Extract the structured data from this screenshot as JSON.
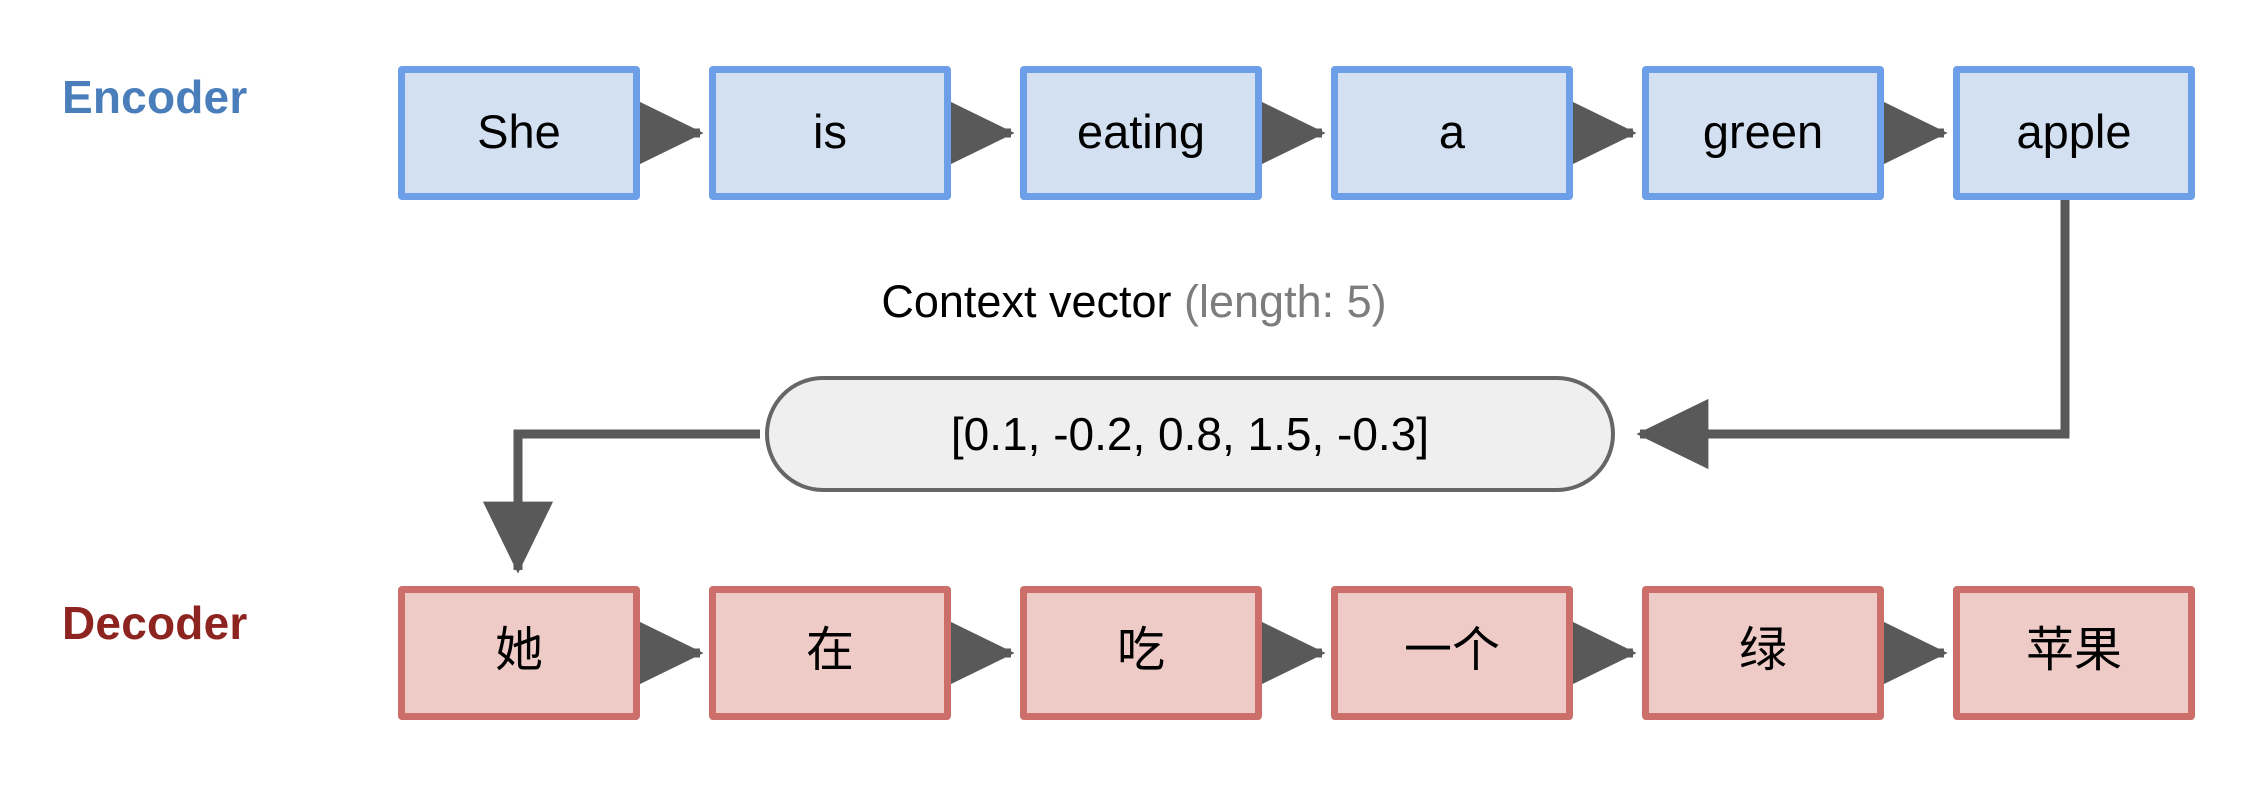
{
  "diagram": {
    "title_encoder_label": "Encoder",
    "title_decoder_label": "Decoder",
    "encoder": {
      "label": "Encoder",
      "label_color": "#4A7EBB",
      "box_fill": "#D2E0F1",
      "box_border": "#6D9EE8",
      "tokens": [
        "She",
        "is",
        "eating",
        "a",
        "green",
        "apple"
      ]
    },
    "decoder": {
      "label": "Decoder",
      "label_color": "#8E2420",
      "box_fill": "#EFCBC8",
      "box_border": "#CC6E69",
      "tokens": [
        "她",
        "在",
        "吃",
        "一个",
        "绿",
        "苹果"
      ]
    },
    "context": {
      "caption_main": "Context vector",
      "caption_suffix": "(length: 5)",
      "caption_suffix_color": "#7D7D7D",
      "values_text": "[0.1, -0.2, 0.8, 1.5, -0.3]",
      "values": [
        0.1,
        -0.2,
        0.8,
        1.5,
        -0.3
      ],
      "length": 5,
      "pill_fill": "#EFEFEF",
      "pill_border": "#666666"
    },
    "arrows": {
      "color": "#595959",
      "encoder_chain_count": 5,
      "decoder_chain_count": 5,
      "encoder_to_context": "apple-box down then left into context vector",
      "context_to_decoder": "context vector left then down into first decoder box"
    }
  }
}
